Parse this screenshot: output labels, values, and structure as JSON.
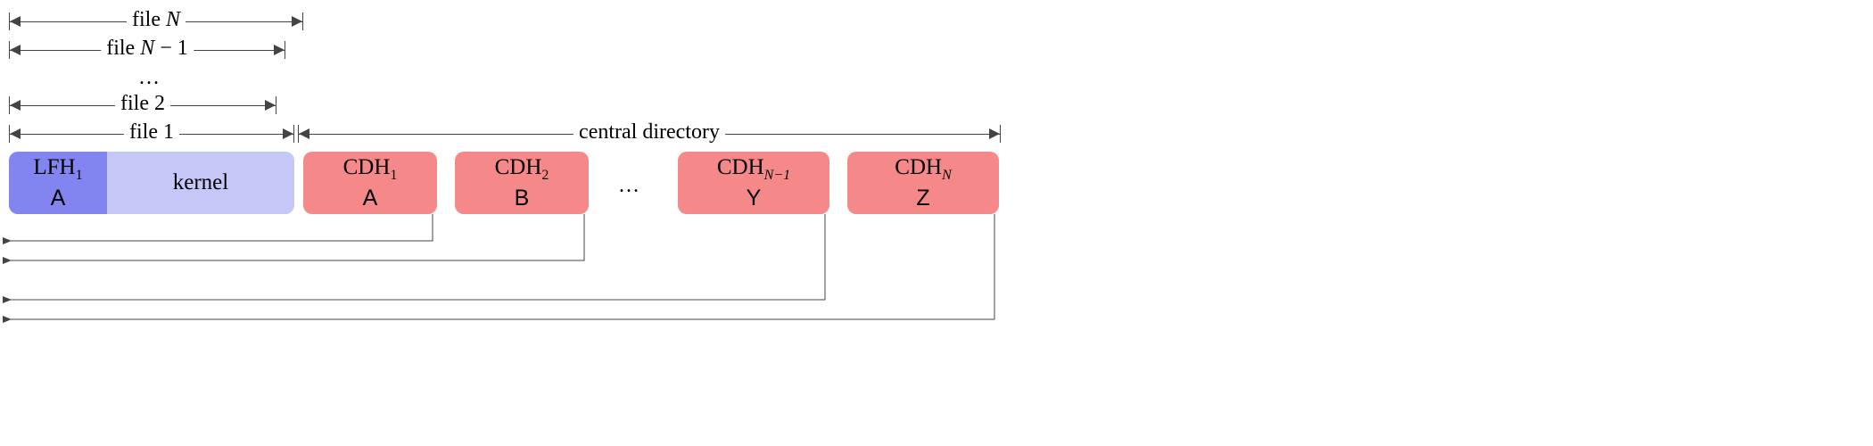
{
  "dimensions": {
    "fileN": "file N",
    "fileNm1": "file N − 1",
    "dotsTop": "…",
    "file2": "file 2",
    "file1": "file 1",
    "central_dir": "central directory"
  },
  "blocks": {
    "lfh": {
      "line1": "LFH",
      "sub": "1",
      "line2": "A"
    },
    "kernel": {
      "label": "kernel"
    },
    "cdh1": {
      "line1": "CDH",
      "sub": "1",
      "line2": "A"
    },
    "cdh2": {
      "line1": "CDH",
      "sub": "2",
      "line2": "B"
    },
    "dots": "…",
    "cdhNm1": {
      "line1": "CDH",
      "sub": "N−1",
      "line2": "Y"
    },
    "cdhN": {
      "line1": "CDH",
      "sub": "N",
      "line2": "Z"
    }
  },
  "colors": {
    "lfh_bg": "#8285f0",
    "kernel_bg": "#c5c8f7",
    "cdh_bg": "#f58989",
    "arrow": "#444"
  }
}
